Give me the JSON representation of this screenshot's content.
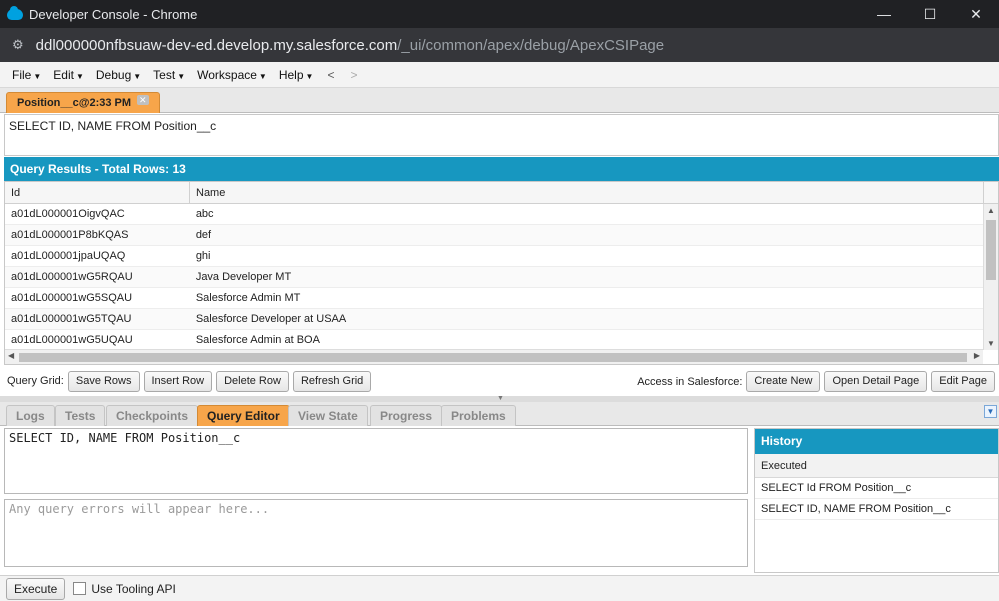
{
  "window": {
    "title": "Developer Console - Chrome",
    "controls": [
      "—",
      "☐",
      "✕"
    ]
  },
  "address": {
    "host": "ddl000000nfbsuaw-dev-ed.develop.my.salesforce.com",
    "path": "/_ui/common/apex/debug/ApexCSIPage"
  },
  "menu": {
    "items": [
      "File",
      "Edit",
      "Debug",
      "Test",
      "Workspace",
      "Help"
    ],
    "back": "<",
    "forward": ">"
  },
  "doc_tab": {
    "label": "Position__c@2:33 PM",
    "close": "✕"
  },
  "query": {
    "text": "SELECT ID, NAME FROM Position__c"
  },
  "results": {
    "header": "Query Results - Total Rows: 13",
    "columns": [
      "Id",
      "Name"
    ],
    "rows": [
      {
        "id": "a01dL000001OigvQAC",
        "name": "abc"
      },
      {
        "id": "a01dL000001P8bKQAS",
        "name": "def"
      },
      {
        "id": "a01dL000001jpaUQAQ",
        "name": "ghi"
      },
      {
        "id": "a01dL000001wG5RQAU",
        "name": "Java Developer MT"
      },
      {
        "id": "a01dL000001wG5SQAU",
        "name": "Salesforce Admin MT"
      },
      {
        "id": "a01dL000001wG5TQAU",
        "name": "Salesforce Developer at USAA"
      },
      {
        "id": "a01dL000001wG5UQAU",
        "name": "Salesforce Admin at BOA"
      }
    ]
  },
  "grid_toolbar": {
    "label": "Query Grid:",
    "save_rows": "Save Rows",
    "insert_row": "Insert Row",
    "delete_row": "Delete Row",
    "refresh_grid": "Refresh Grid",
    "access_label": "Access in Salesforce:",
    "create_new": "Create New",
    "open_detail": "Open Detail Page",
    "edit_page": "Edit Page"
  },
  "bottom_tabs": [
    "Logs",
    "Tests",
    "Checkpoints",
    "Query Editor",
    "View State",
    "Progress",
    "Problems"
  ],
  "active_bottom_tab": "Query Editor",
  "editor": {
    "text": "SELECT ID, NAME FROM Position__c",
    "errors_placeholder": "Any query errors will appear here..."
  },
  "history": {
    "title": "History",
    "subheader": "Executed",
    "items": [
      "SELECT Id FROM Position__c",
      "SELECT ID, NAME FROM Position__c"
    ]
  },
  "execute": {
    "button": "Execute",
    "tooling_label": "Use Tooling API",
    "tooling_checked": false
  }
}
